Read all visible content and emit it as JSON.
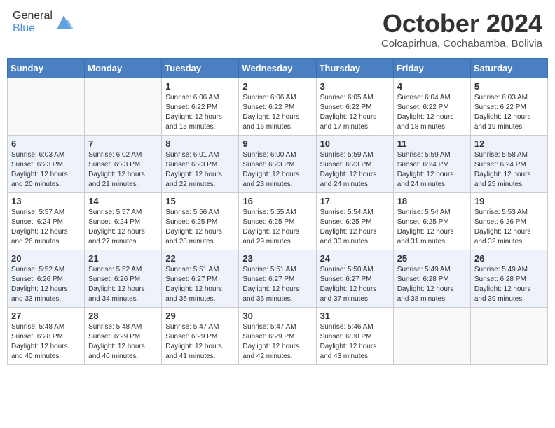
{
  "header": {
    "logo_general": "General",
    "logo_blue": "Blue",
    "month_title": "October 2024",
    "subtitle": "Colcapirhua, Cochabamba, Bolivia"
  },
  "weekdays": [
    "Sunday",
    "Monday",
    "Tuesday",
    "Wednesday",
    "Thursday",
    "Friday",
    "Saturday"
  ],
  "weeks": [
    [
      {
        "day": "",
        "sunrise": "",
        "sunset": "",
        "daylight": ""
      },
      {
        "day": "",
        "sunrise": "",
        "sunset": "",
        "daylight": ""
      },
      {
        "day": "1",
        "sunrise": "Sunrise: 6:06 AM",
        "sunset": "Sunset: 6:22 PM",
        "daylight": "Daylight: 12 hours and 15 minutes."
      },
      {
        "day": "2",
        "sunrise": "Sunrise: 6:06 AM",
        "sunset": "Sunset: 6:22 PM",
        "daylight": "Daylight: 12 hours and 16 minutes."
      },
      {
        "day": "3",
        "sunrise": "Sunrise: 6:05 AM",
        "sunset": "Sunset: 6:22 PM",
        "daylight": "Daylight: 12 hours and 17 minutes."
      },
      {
        "day": "4",
        "sunrise": "Sunrise: 6:04 AM",
        "sunset": "Sunset: 6:22 PM",
        "daylight": "Daylight: 12 hours and 18 minutes."
      },
      {
        "day": "5",
        "sunrise": "Sunrise: 6:03 AM",
        "sunset": "Sunset: 6:22 PM",
        "daylight": "Daylight: 12 hours and 19 minutes."
      }
    ],
    [
      {
        "day": "6",
        "sunrise": "Sunrise: 6:03 AM",
        "sunset": "Sunset: 6:23 PM",
        "daylight": "Daylight: 12 hours and 20 minutes."
      },
      {
        "day": "7",
        "sunrise": "Sunrise: 6:02 AM",
        "sunset": "Sunset: 6:23 PM",
        "daylight": "Daylight: 12 hours and 21 minutes."
      },
      {
        "day": "8",
        "sunrise": "Sunrise: 6:01 AM",
        "sunset": "Sunset: 6:23 PM",
        "daylight": "Daylight: 12 hours and 22 minutes."
      },
      {
        "day": "9",
        "sunrise": "Sunrise: 6:00 AM",
        "sunset": "Sunset: 6:23 PM",
        "daylight": "Daylight: 12 hours and 23 minutes."
      },
      {
        "day": "10",
        "sunrise": "Sunrise: 5:59 AM",
        "sunset": "Sunset: 6:23 PM",
        "daylight": "Daylight: 12 hours and 24 minutes."
      },
      {
        "day": "11",
        "sunrise": "Sunrise: 5:59 AM",
        "sunset": "Sunset: 6:24 PM",
        "daylight": "Daylight: 12 hours and 24 minutes."
      },
      {
        "day": "12",
        "sunrise": "Sunrise: 5:58 AM",
        "sunset": "Sunset: 6:24 PM",
        "daylight": "Daylight: 12 hours and 25 minutes."
      }
    ],
    [
      {
        "day": "13",
        "sunrise": "Sunrise: 5:57 AM",
        "sunset": "Sunset: 6:24 PM",
        "daylight": "Daylight: 12 hours and 26 minutes."
      },
      {
        "day": "14",
        "sunrise": "Sunrise: 5:57 AM",
        "sunset": "Sunset: 6:24 PM",
        "daylight": "Daylight: 12 hours and 27 minutes."
      },
      {
        "day": "15",
        "sunrise": "Sunrise: 5:56 AM",
        "sunset": "Sunset: 6:25 PM",
        "daylight": "Daylight: 12 hours and 28 minutes."
      },
      {
        "day": "16",
        "sunrise": "Sunrise: 5:55 AM",
        "sunset": "Sunset: 6:25 PM",
        "daylight": "Daylight: 12 hours and 29 minutes."
      },
      {
        "day": "17",
        "sunrise": "Sunrise: 5:54 AM",
        "sunset": "Sunset: 6:25 PM",
        "daylight": "Daylight: 12 hours and 30 minutes."
      },
      {
        "day": "18",
        "sunrise": "Sunrise: 5:54 AM",
        "sunset": "Sunset: 6:25 PM",
        "daylight": "Daylight: 12 hours and 31 minutes."
      },
      {
        "day": "19",
        "sunrise": "Sunrise: 5:53 AM",
        "sunset": "Sunset: 6:26 PM",
        "daylight": "Daylight: 12 hours and 32 minutes."
      }
    ],
    [
      {
        "day": "20",
        "sunrise": "Sunrise: 5:52 AM",
        "sunset": "Sunset: 6:26 PM",
        "daylight": "Daylight: 12 hours and 33 minutes."
      },
      {
        "day": "21",
        "sunrise": "Sunrise: 5:52 AM",
        "sunset": "Sunset: 6:26 PM",
        "daylight": "Daylight: 12 hours and 34 minutes."
      },
      {
        "day": "22",
        "sunrise": "Sunrise: 5:51 AM",
        "sunset": "Sunset: 6:27 PM",
        "daylight": "Daylight: 12 hours and 35 minutes."
      },
      {
        "day": "23",
        "sunrise": "Sunrise: 5:51 AM",
        "sunset": "Sunset: 6:27 PM",
        "daylight": "Daylight: 12 hours and 36 minutes."
      },
      {
        "day": "24",
        "sunrise": "Sunrise: 5:50 AM",
        "sunset": "Sunset: 6:27 PM",
        "daylight": "Daylight: 12 hours and 37 minutes."
      },
      {
        "day": "25",
        "sunrise": "Sunrise: 5:49 AM",
        "sunset": "Sunset: 6:28 PM",
        "daylight": "Daylight: 12 hours and 38 minutes."
      },
      {
        "day": "26",
        "sunrise": "Sunrise: 5:49 AM",
        "sunset": "Sunset: 6:28 PM",
        "daylight": "Daylight: 12 hours and 39 minutes."
      }
    ],
    [
      {
        "day": "27",
        "sunrise": "Sunrise: 5:48 AM",
        "sunset": "Sunset: 6:28 PM",
        "daylight": "Daylight: 12 hours and 40 minutes."
      },
      {
        "day": "28",
        "sunrise": "Sunrise: 5:48 AM",
        "sunset": "Sunset: 6:29 PM",
        "daylight": "Daylight: 12 hours and 40 minutes."
      },
      {
        "day": "29",
        "sunrise": "Sunrise: 5:47 AM",
        "sunset": "Sunset: 6:29 PM",
        "daylight": "Daylight: 12 hours and 41 minutes."
      },
      {
        "day": "30",
        "sunrise": "Sunrise: 5:47 AM",
        "sunset": "Sunset: 6:29 PM",
        "daylight": "Daylight: 12 hours and 42 minutes."
      },
      {
        "day": "31",
        "sunrise": "Sunrise: 5:46 AM",
        "sunset": "Sunset: 6:30 PM",
        "daylight": "Daylight: 12 hours and 43 minutes."
      },
      {
        "day": "",
        "sunrise": "",
        "sunset": "",
        "daylight": ""
      },
      {
        "day": "",
        "sunrise": "",
        "sunset": "",
        "daylight": ""
      }
    ]
  ]
}
